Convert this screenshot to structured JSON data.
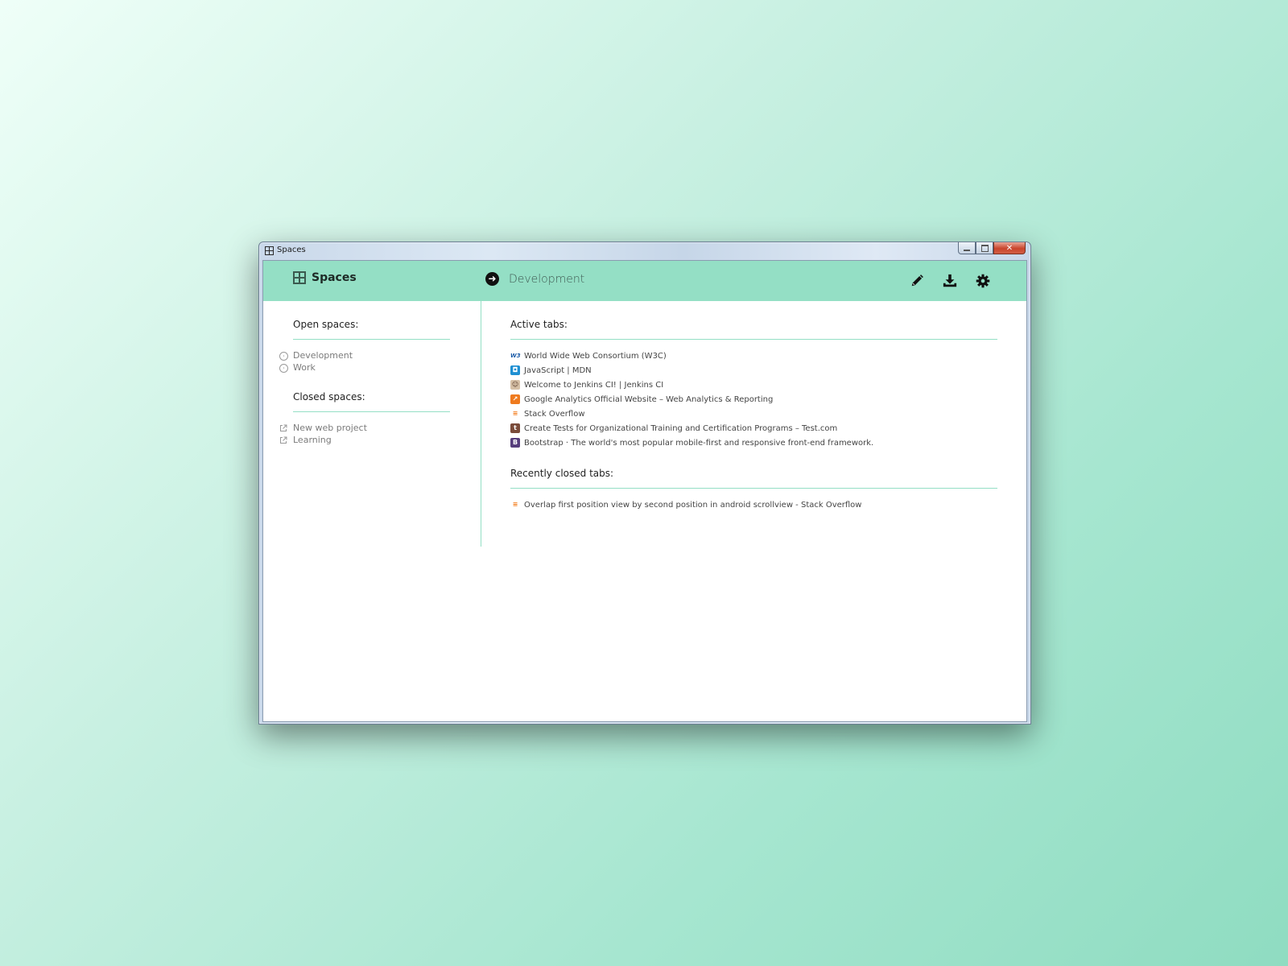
{
  "window": {
    "title": "Spaces"
  },
  "header": {
    "brand_name": "Spaces",
    "current_space": "Development",
    "actions": [
      {
        "name": "edit",
        "icon": "pencil-icon"
      },
      {
        "name": "export",
        "icon": "download-icon"
      },
      {
        "name": "settings",
        "icon": "gear-icon"
      }
    ]
  },
  "sidebar": {
    "open_title": "Open spaces:",
    "open_spaces": [
      {
        "label": "Development",
        "icon": "circle-arrow-icon"
      },
      {
        "label": "Work",
        "icon": "circle-arrow-icon"
      }
    ],
    "closed_title": "Closed spaces:",
    "closed_spaces": [
      {
        "label": "New web project",
        "icon": "external-link-icon"
      },
      {
        "label": "Learning",
        "icon": "external-link-icon"
      }
    ]
  },
  "main": {
    "active_title": "Active tabs:",
    "active_tabs": [
      {
        "title": "World Wide Web Consortium (W3C)",
        "favicon": "w3c-favicon",
        "fav_text": "W3",
        "fav_color": "#ffffff",
        "fav_text_color": "#1a5aa7"
      },
      {
        "title": "JavaScript | MDN",
        "favicon": "mdn-favicon",
        "fav_text": "◘",
        "fav_color": "#1e8fd2",
        "fav_text_color": "#ffffff"
      },
      {
        "title": "Welcome to Jenkins CI! | Jenkins CI",
        "favicon": "jenkins-favicon",
        "fav_text": "☺",
        "fav_color": "#d6c0a6",
        "fav_text_color": "#5a3d2b"
      },
      {
        "title": "Google Analytics Official Website – Web Analytics & Reporting",
        "favicon": "analytics-favicon",
        "fav_text": "↗",
        "fav_color": "#ef7a1e",
        "fav_text_color": "#ffffff"
      },
      {
        "title": "Stack Overflow",
        "favicon": "stackoverflow-favicon",
        "fav_text": "≡",
        "fav_color": "#ffffff",
        "fav_text_color": "#f48024"
      },
      {
        "title": "Create Tests for Organizational Training and Certification Programs – Test.com",
        "favicon": "testcom-favicon",
        "fav_text": "t",
        "fav_color": "#7a4b3a",
        "fav_text_color": "#ffffff"
      },
      {
        "title": "Bootstrap · The world's most popular mobile-first and responsive front-end framework.",
        "favicon": "bootstrap-favicon",
        "fav_text": "B",
        "fav_color": "#563d7c",
        "fav_text_color": "#ffffff"
      }
    ],
    "closed_title": "Recently closed tabs:",
    "closed_tabs": [
      {
        "title": "Overlap first position view by second position in android scrollview - Stack Overflow",
        "favicon": "stackoverflow-favicon",
        "fav_text": "≡",
        "fav_color": "#ffffff",
        "fav_text_color": "#f48024"
      }
    ]
  },
  "colors": {
    "accent": "#94dfc5",
    "header_text": "#1e2a26"
  }
}
